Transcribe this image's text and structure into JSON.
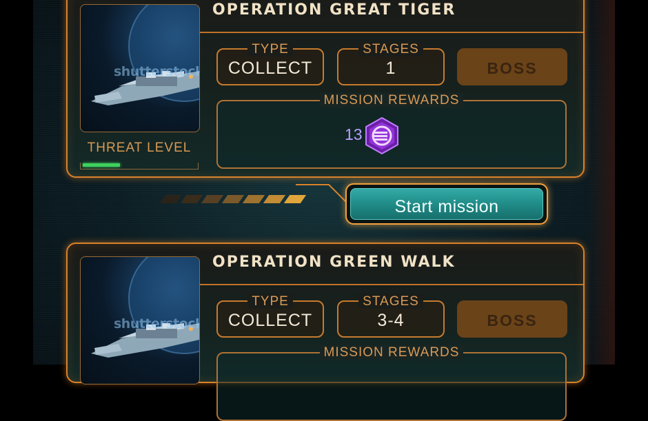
{
  "missions": [
    {
      "title": "OPERATION GREAT TIGER",
      "type_label": "TYPE",
      "type_value": "COLLECT",
      "stages_label": "STAGES",
      "stages_value": "1",
      "boss_label": "BOSS",
      "rewards_label": "MISSION REWARDS",
      "reward_count": "13",
      "reward_icon": "purple-hexagon-token-icon",
      "threat_label": "THREAT LEVEL",
      "threat_level_fraction": 0.33,
      "watermark": "shutterstock",
      "start_label": "Start mission"
    },
    {
      "title": "OPERATION GREEN WALK",
      "type_label": "TYPE",
      "type_value": "COLLECT",
      "stages_label": "STAGES",
      "stages_value": "3-4",
      "boss_label": "BOSS",
      "rewards_label": "MISSION REWARDS",
      "watermark": "shutterstock"
    }
  ],
  "colors": {
    "accent_orange": "#d9822a",
    "teal_button": "#1f8985",
    "threat_green": "#3fd15d",
    "reward_purple": "#8e2bd6"
  }
}
